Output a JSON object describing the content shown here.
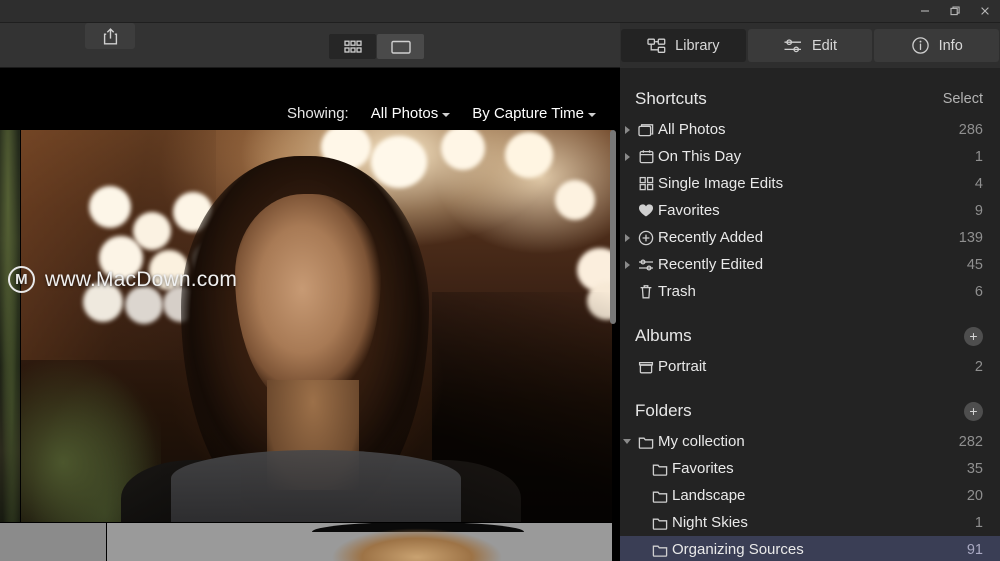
{
  "window": {
    "controls": [
      {
        "name": "minimize-button",
        "glyph": "minimize"
      },
      {
        "name": "restore-button",
        "glyph": "restore"
      },
      {
        "name": "close-button",
        "glyph": "close"
      }
    ]
  },
  "toolbar": {
    "share_label": "Share",
    "views": [
      {
        "id": "grid",
        "icon": "grid-icon",
        "selected": false
      },
      {
        "id": "single",
        "icon": "single-image-icon",
        "selected": true
      }
    ]
  },
  "tabs": [
    {
      "id": "library",
      "label": "Library",
      "icon": "library-icon",
      "selected": true
    },
    {
      "id": "edit",
      "label": "Edit",
      "icon": "sliders-icon",
      "selected": false
    },
    {
      "id": "info",
      "label": "Info",
      "icon": "info-icon",
      "selected": false
    }
  ],
  "filterbar": {
    "showing_label": "Showing:",
    "source_value": "All Photos",
    "sort_value": "By Capture Time"
  },
  "watermark": {
    "text": "www.MacDown.com",
    "logo_letter": "M"
  },
  "sidebar": {
    "shortcuts": {
      "title": "Shortcuts",
      "action": "Select",
      "items": [
        {
          "label": "All Photos",
          "count": "286",
          "icon": "all-photos-icon",
          "disclosure": "collapsed"
        },
        {
          "label": "On This Day",
          "count": "1",
          "icon": "calendar-icon",
          "disclosure": "collapsed"
        },
        {
          "label": "Single Image Edits",
          "count": "4",
          "icon": "grid-squares-icon",
          "disclosure": "none"
        },
        {
          "label": "Favorites",
          "count": "9",
          "icon": "heart-icon",
          "disclosure": "none"
        },
        {
          "label": "Recently Added",
          "count": "139",
          "icon": "plus-circle-icon",
          "disclosure": "collapsed"
        },
        {
          "label": "Recently Edited",
          "count": "45",
          "icon": "sliders-icon",
          "disclosure": "collapsed"
        },
        {
          "label": "Trash",
          "count": "6",
          "icon": "trash-icon",
          "disclosure": "none"
        }
      ]
    },
    "albums": {
      "title": "Albums",
      "action": "+",
      "items": [
        {
          "label": "Portrait",
          "count": "2",
          "icon": "album-icon",
          "disclosure": "none"
        }
      ]
    },
    "folders": {
      "title": "Folders",
      "action": "+",
      "items": [
        {
          "label": "My collection",
          "count": "282",
          "icon": "folder-icon",
          "disclosure": "expanded",
          "indent": 0,
          "selected": false
        },
        {
          "label": "Favorites",
          "count": "35",
          "icon": "folder-icon",
          "disclosure": "none",
          "indent": 1,
          "selected": false
        },
        {
          "label": "Landscape",
          "count": "20",
          "icon": "folder-icon",
          "disclosure": "none",
          "indent": 1,
          "selected": false
        },
        {
          "label": "Night Skies",
          "count": "1",
          "icon": "folder-icon",
          "disclosure": "none",
          "indent": 1,
          "selected": false
        },
        {
          "label": "Organizing Sources",
          "count": "91",
          "icon": "folder-icon",
          "disclosure": "none",
          "indent": 1,
          "selected": true
        }
      ]
    }
  },
  "colors": {
    "app_bg": "#2b2b2b",
    "sidebar_bg": "#232323",
    "toolbar_bg": "#333333",
    "tab_selected_bg": "#232323",
    "tab_unselected_bg": "#3a3a3a",
    "row_selected_bg": "#3a3e55",
    "text_primary": "#e9e9e9",
    "text_muted": "#8f8f8f"
  }
}
